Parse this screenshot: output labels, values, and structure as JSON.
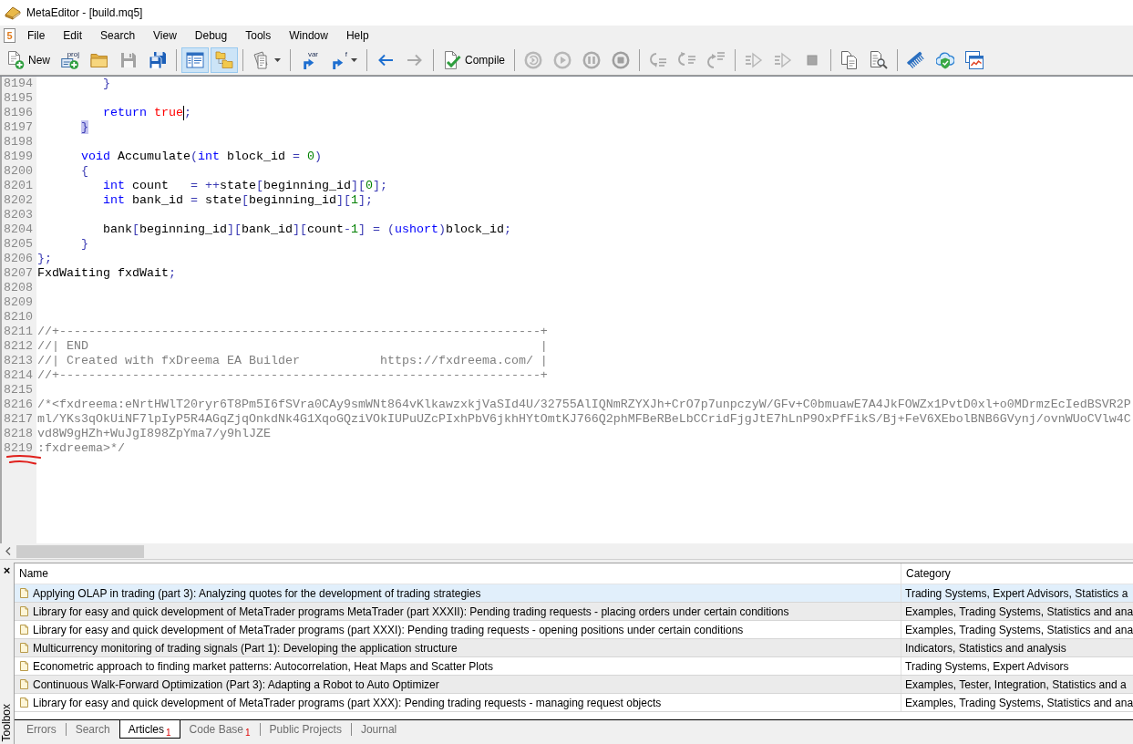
{
  "window": {
    "title": "MetaEditor - [build.mq5]"
  },
  "menu_bar": {
    "icon_text": "5",
    "items": [
      "File",
      "Edit",
      "Search",
      "View",
      "Debug",
      "Tools",
      "Window",
      "Help"
    ]
  },
  "toolbar": {
    "groups": [
      [
        {
          "label": "New",
          "pressed": false,
          "disabled": false,
          "dropdown": false
        },
        {
          "icon_text": "proj",
          "pressed": false,
          "disabled": false,
          "dropdown": false
        },
        {
          "pressed": false,
          "disabled": false,
          "dropdown": false
        },
        {
          "pressed": false,
          "disabled": true,
          "dropdown": false
        },
        {
          "pressed": false,
          "disabled": false,
          "dropdown": false
        }
      ],
      [
        {
          "pressed": true,
          "disabled": false,
          "dropdown": false
        },
        {
          "pressed": true,
          "disabled": false,
          "dropdown": false
        }
      ],
      [
        {
          "pressed": false,
          "disabled": false,
          "dropdown": true
        }
      ],
      [
        {
          "icon_text": "var",
          "pressed": false,
          "disabled": false,
          "dropdown": false
        },
        {
          "icon_text": "f",
          "pressed": false,
          "disabled": false,
          "dropdown": true
        }
      ],
      [
        {
          "pressed": false,
          "disabled": false,
          "dropdown": false
        },
        {
          "pressed": false,
          "disabled": true,
          "dropdown": false
        }
      ],
      [
        {
          "label": "Compile",
          "pressed": false,
          "disabled": false,
          "dropdown": false
        }
      ],
      [
        {
          "pressed": false,
          "disabled": true,
          "dropdown": false
        },
        {
          "pressed": false,
          "disabled": true,
          "dropdown": false
        },
        {
          "pressed": false,
          "disabled": true,
          "dropdown": false
        },
        {
          "pressed": false,
          "disabled": true,
          "dropdown": false
        }
      ],
      [
        {
          "pressed": false,
          "disabled": true,
          "dropdown": false
        },
        {
          "pressed": false,
          "disabled": true,
          "dropdown": false
        },
        {
          "pressed": false,
          "disabled": true,
          "dropdown": false
        }
      ],
      [
        {
          "pressed": false,
          "disabled": true,
          "dropdown": false
        },
        {
          "pressed": false,
          "disabled": true,
          "dropdown": false
        },
        {
          "pressed": false,
          "disabled": true,
          "dropdown": false
        }
      ],
      [
        {
          "pressed": false,
          "disabled": false,
          "dropdown": false
        },
        {
          "pressed": false,
          "disabled": false,
          "dropdown": false
        }
      ],
      [
        {
          "pressed": false,
          "disabled": false,
          "dropdown": false
        },
        {
          "pressed": false,
          "disabled": false,
          "dropdown": false
        },
        {
          "pressed": false,
          "disabled": false,
          "dropdown": false
        }
      ]
    ]
  },
  "editor": {
    "lines": [
      {
        "number": "8194",
        "marked": false,
        "tokens": [
          {
            "kind": "operator",
            "text": "         }"
          }
        ]
      },
      {
        "number": "8195",
        "marked": false
      },
      {
        "number": "8196",
        "marked": false,
        "tokens": [
          {
            "kind": "keyword",
            "text": "         return"
          },
          {
            "kind": "constant",
            "text": " true"
          },
          {
            "kind": "caret"
          },
          {
            "kind": "operator",
            "text": ";"
          }
        ]
      },
      {
        "number": "8197",
        "marked": false,
        "tokens": [
          {
            "kind": "matched",
            "text": "      }"
          }
        ]
      },
      {
        "number": "8198",
        "marked": false
      },
      {
        "number": "8199",
        "marked": false,
        "tokens": [
          {
            "kind": "keyword",
            "text": "      void"
          },
          {
            "kind": "plain",
            "text": " Accumulate"
          },
          {
            "kind": "operator",
            "text": "("
          },
          {
            "kind": "keyword",
            "text": "int"
          },
          {
            "kind": "plain",
            "text": " block_id "
          },
          {
            "kind": "operator",
            "text": "="
          },
          {
            "kind": "number",
            "text": " 0"
          },
          {
            "kind": "operator",
            "text": ")"
          }
        ]
      },
      {
        "number": "8200",
        "marked": false,
        "tokens": [
          {
            "kind": "operator",
            "text": "      {"
          }
        ]
      },
      {
        "number": "8201",
        "marked": false,
        "tokens": [
          {
            "kind": "keyword",
            "text": "         int"
          },
          {
            "kind": "plain",
            "text": " count   "
          },
          {
            "kind": "operator",
            "text": "= ++"
          },
          {
            "kind": "plain",
            "text": "state"
          },
          {
            "kind": "operator",
            "text": "["
          },
          {
            "kind": "plain",
            "text": "beginning_id"
          },
          {
            "kind": "operator",
            "text": "]["
          },
          {
            "kind": "number",
            "text": "0"
          },
          {
            "kind": "operator",
            "text": "];"
          }
        ]
      },
      {
        "number": "8202",
        "marked": false,
        "tokens": [
          {
            "kind": "keyword",
            "text": "         int"
          },
          {
            "kind": "plain",
            "text": " bank_id "
          },
          {
            "kind": "operator",
            "text": "="
          },
          {
            "kind": "plain",
            "text": " state"
          },
          {
            "kind": "operator",
            "text": "["
          },
          {
            "kind": "plain",
            "text": "beginning_id"
          },
          {
            "kind": "operator",
            "text": "]["
          },
          {
            "kind": "number",
            "text": "1"
          },
          {
            "kind": "operator",
            "text": "];"
          }
        ]
      },
      {
        "number": "8203",
        "marked": false
      },
      {
        "number": "8204",
        "marked": false,
        "tokens": [
          {
            "kind": "plain",
            "text": "         bank"
          },
          {
            "kind": "operator",
            "text": "["
          },
          {
            "kind": "plain",
            "text": "beginning_id"
          },
          {
            "kind": "operator",
            "text": "]["
          },
          {
            "kind": "plain",
            "text": "bank_id"
          },
          {
            "kind": "operator",
            "text": "]["
          },
          {
            "kind": "plain",
            "text": "count"
          },
          {
            "kind": "operator",
            "text": "-"
          },
          {
            "kind": "number",
            "text": "1"
          },
          {
            "kind": "operator",
            "text": "] = ("
          },
          {
            "kind": "keyword",
            "text": "ushort"
          },
          {
            "kind": "operator",
            "text": ")"
          },
          {
            "kind": "plain",
            "text": "block_id"
          },
          {
            "kind": "operator",
            "text": ";"
          }
        ]
      },
      {
        "number": "8205",
        "marked": false,
        "tokens": [
          {
            "kind": "operator",
            "text": "      }"
          }
        ]
      },
      {
        "number": "8206",
        "marked": false,
        "tokens": [
          {
            "kind": "operator",
            "text": "};"
          }
        ]
      },
      {
        "number": "8207",
        "marked": false,
        "tokens": [
          {
            "kind": "plain",
            "text": "FxdWaiting fxdWait"
          },
          {
            "kind": "operator",
            "text": ";"
          }
        ]
      },
      {
        "number": "8208",
        "marked": false
      },
      {
        "number": "8209",
        "marked": false
      },
      {
        "number": "8210",
        "marked": false
      },
      {
        "number": "8211",
        "marked": false,
        "tokens": [
          {
            "kind": "comment",
            "text": "//+------------------------------------------------------------------+"
          }
        ]
      },
      {
        "number": "8212",
        "marked": false,
        "tokens": [
          {
            "kind": "comment",
            "text": "//| END                                                              |"
          }
        ]
      },
      {
        "number": "8213",
        "marked": false,
        "tokens": [
          {
            "kind": "comment",
            "text": "//| Created with fxDreema EA Builder           https://fxdreema.com/ |"
          }
        ]
      },
      {
        "number": "8214",
        "marked": false,
        "tokens": [
          {
            "kind": "comment",
            "text": "//+------------------------------------------------------------------+"
          }
        ]
      },
      {
        "number": "8215",
        "marked": false
      },
      {
        "number": "8216",
        "marked": false,
        "tokens": [
          {
            "kind": "comment",
            "text": "/*<fxdreema:eNrtHWlT20ryr6T8Pm5I6fSVra0CAy9smWNt864vKlkawzxkjVaSId4U/32755AlIQNmRZYXJh+CrO7p7unpczyW/GFv+C0bmuawE7A4JkFOWZx1PvtD0xl+o0MDrmzEcIedBSVR2P"
          }
        ]
      },
      {
        "number": "8217",
        "marked": false,
        "tokens": [
          {
            "kind": "comment",
            "text": "ml/YKs3qOkUiNF7lpIyP5R4AGqZjqOnkdNk4G1XqoGQziVOkIUPuUZcPIxhPbV6jkhHYtOmtKJ766Q2phMFBeRBeLbCCridFjgJtE7hLnP9OxPfFikS/Bj+FeV6XEbolBNB6GVynj/ovnWUoCVlw4C"
          }
        ]
      },
      {
        "number": "8218",
        "marked": false,
        "tokens": [
          {
            "kind": "comment",
            "text": "vd8W9gHZh+WuJgI898ZpYma7/y9hlJZE"
          }
        ]
      },
      {
        "number": "8219",
        "marked": true,
        "tokens": [
          {
            "kind": "comment",
            "text": ":fxdreema>*/"
          }
        ]
      }
    ]
  },
  "toolbox": {
    "close_button": "×",
    "title": "Toolbox",
    "columns": [
      "Name",
      "Category"
    ],
    "rows": [
      {
        "name": "Applying OLAP in trading (part 3): Analyzing quotes for the development of trading strategies",
        "category": "Trading Systems, Expert Advisors, Statistics a",
        "selected": true
      },
      {
        "name": "Library for easy and quick development of MetaTrader programs MetaTrader (part XXXII): Pending trading requests - placing orders under certain conditions",
        "category": "Examples, Trading Systems, Statistics and ana",
        "selected": false
      },
      {
        "name": "Library for easy and quick development of MetaTrader programs (part XXXI): Pending trading requests - opening positions under certain conditions",
        "category": "Examples, Trading Systems, Statistics and ana",
        "selected": false
      },
      {
        "name": "Multicurrency monitoring of trading signals (Part 1): Developing the application structure",
        "category": "Indicators, Statistics and analysis",
        "selected": false
      },
      {
        "name": "Econometric approach to finding market patterns: Autocorrelation, Heat Maps and Scatter Plots",
        "category": "Trading Systems, Expert Advisors",
        "selected": false
      },
      {
        "name": "Continuous Walk-Forward Optimization (Part 3): Adapting a Robot to Auto Optimizer",
        "category": "Examples, Tester, Integration, Statistics and a",
        "selected": false
      },
      {
        "name": "Library for easy and quick development of MetaTrader programs (part XXX): Pending trading requests - managing request objects",
        "category": "Examples, Trading Systems, Statistics and ana",
        "selected": false
      }
    ],
    "tabs": [
      {
        "label": "Errors",
        "selected": false
      },
      {
        "label": "Search",
        "selected": false
      },
      {
        "label": "Articles",
        "selected": true,
        "count": "1"
      },
      {
        "label": "Code Base",
        "selected": false,
        "count": "1"
      },
      {
        "label": "Public Projects",
        "selected": false
      },
      {
        "label": "Journal",
        "selected": false
      }
    ]
  }
}
